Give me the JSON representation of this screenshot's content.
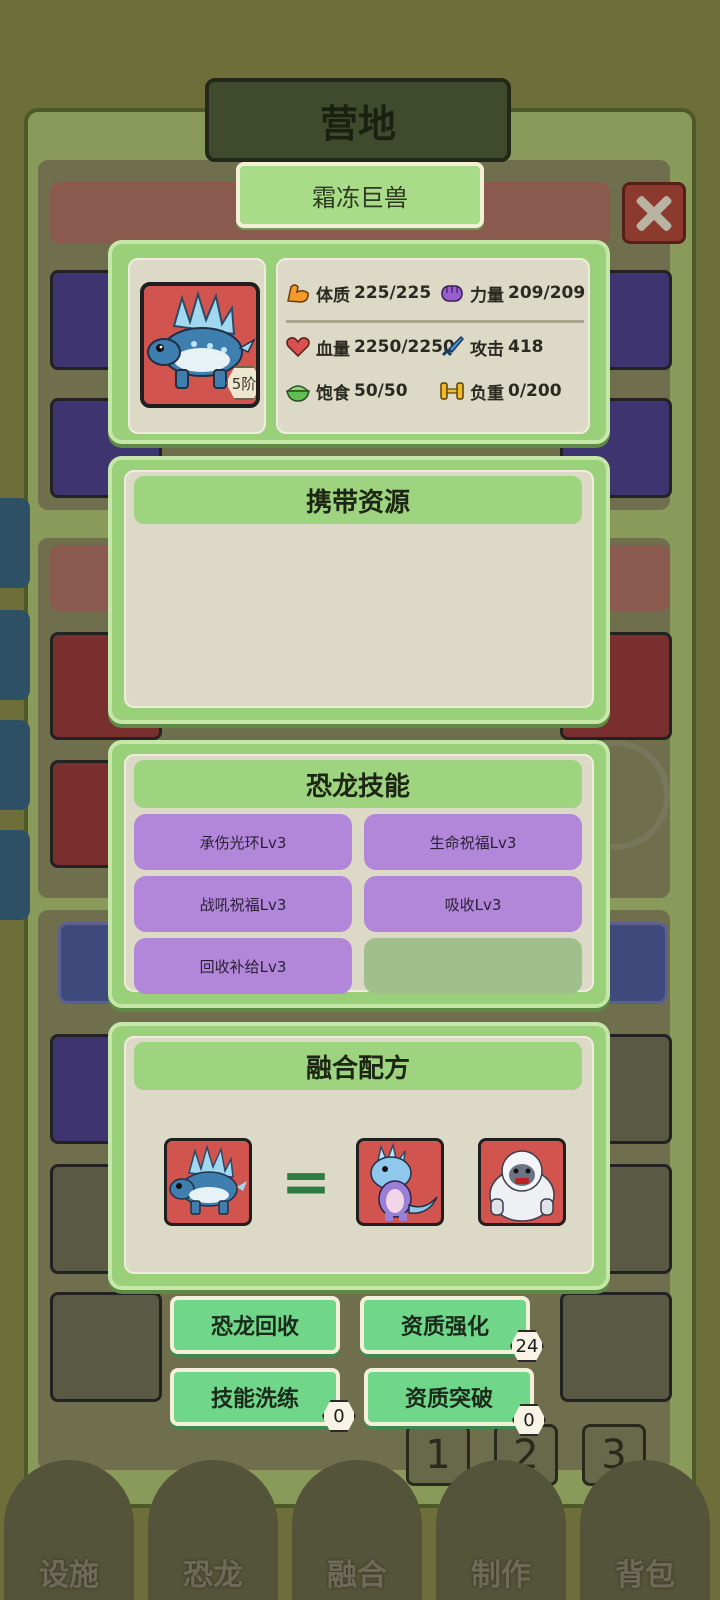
{
  "background": {
    "page_buttons": [
      "1",
      "2",
      "3"
    ],
    "nav": [
      {
        "label": "设施"
      },
      {
        "label": "恐龙"
      },
      {
        "label": "融合"
      },
      {
        "label": "制作"
      },
      {
        "label": "背包"
      }
    ]
  },
  "header": {
    "camp_title": "营地",
    "dino_name": "霜冻巨兽"
  },
  "dino": {
    "rank_badge": "5阶",
    "stats": {
      "constitution_label": "体质",
      "constitution_value": "225/225",
      "strength_label": "力量",
      "strength_value": "209/209",
      "hp_label": "血量",
      "hp_value": "2250/2250",
      "attack_label": "攻击",
      "attack_value": "418",
      "satiety_label": "饱食",
      "satiety_value": "50/50",
      "load_label": "负重",
      "load_value": "0/200"
    }
  },
  "resources": {
    "title": "携带资源"
  },
  "skills": {
    "title": "恐龙技能",
    "items": [
      "承伤光环Lv3",
      "生命祝福Lv3",
      "战吼祝福Lv3",
      "吸收Lv3",
      "回收补给Lv3",
      ""
    ]
  },
  "fusion": {
    "title": "融合配方",
    "equals": "="
  },
  "actions": {
    "recycle_label": "恐龙回收",
    "enhance_label": "资质强化",
    "enhance_count": "24",
    "reroll_label": "技能洗练",
    "reroll_count": "0",
    "breakthrough_label": "资质突破",
    "breakthrough_count": "0"
  },
  "colors": {
    "panel_green": "#9bd07a",
    "skill_purple": "#b287d9",
    "action_green": "#6fd68a",
    "portrait_red": "#d2544f"
  },
  "icons": {
    "constitution": "flexed-arm-icon",
    "strength": "fist-icon",
    "hp": "heart-icon",
    "attack": "sword-icon",
    "satiety": "food-bowl-icon",
    "load": "dumbbell-icon",
    "close": "close-icon"
  }
}
